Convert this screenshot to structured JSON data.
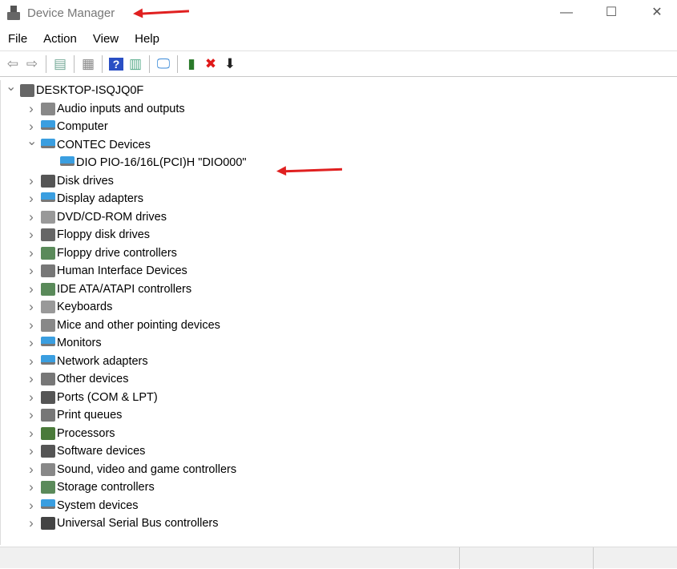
{
  "window": {
    "title": "Device Manager",
    "minimize": "—",
    "maximize": "☐",
    "close": "✕"
  },
  "menu": [
    "File",
    "Action",
    "View",
    "Help"
  ],
  "toolbar": [
    {
      "name": "back",
      "glyph": "⇦",
      "color": "#888"
    },
    {
      "name": "forward",
      "glyph": "⇨",
      "color": "#888"
    },
    {
      "sep": true
    },
    {
      "name": "show-hide-console-tree",
      "glyph": "▤",
      "color": "#7a9"
    },
    {
      "sep": true
    },
    {
      "name": "properties",
      "glyph": "▦",
      "color": "#888"
    },
    {
      "sep": true
    },
    {
      "name": "help",
      "glyph": "?",
      "color": "#fff",
      "bg": "#2a4fc4"
    },
    {
      "name": "show-action-pane",
      "glyph": "▥",
      "color": "#5a8"
    },
    {
      "sep": true
    },
    {
      "name": "scan-hardware",
      "glyph": "🖵",
      "color": "#3a8ad8"
    },
    {
      "sep": true
    },
    {
      "name": "update-driver",
      "glyph": "▮",
      "color": "#2a7a2a"
    },
    {
      "name": "uninstall",
      "glyph": "✖",
      "color": "#e01818"
    },
    {
      "name": "enable-device",
      "glyph": "⬇",
      "color": "#222"
    }
  ],
  "tree": {
    "root": "DESKTOP-ISQJQ0F",
    "items": [
      {
        "label": "Audio inputs and outputs",
        "icon": "speaker",
        "color": "#888"
      },
      {
        "label": "Computer",
        "icon": "monitor",
        "color": "#3a9ee0"
      },
      {
        "label": "CONTEC Devices",
        "icon": "network",
        "color": "#3a9ee0",
        "expanded": true,
        "children": [
          {
            "label": "DIO PIO-16/16L(PCI)H \"DIO000\"",
            "icon": "network",
            "color": "#3a9ee0"
          }
        ]
      },
      {
        "label": "Disk drives",
        "icon": "disk",
        "color": "#555"
      },
      {
        "label": "Display adapters",
        "icon": "display",
        "color": "#3a9ee0"
      },
      {
        "label": "DVD/CD-ROM drives",
        "icon": "dvd",
        "color": "#999"
      },
      {
        "label": "Floppy disk drives",
        "icon": "floppy",
        "color": "#666"
      },
      {
        "label": "Floppy drive controllers",
        "icon": "controller",
        "color": "#5a8a5a"
      },
      {
        "label": "Human Interface Devices",
        "icon": "hid",
        "color": "#777"
      },
      {
        "label": "IDE ATA/ATAPI controllers",
        "icon": "ide",
        "color": "#5a8a5a"
      },
      {
        "label": "Keyboards",
        "icon": "keyboard",
        "color": "#999"
      },
      {
        "label": "Mice and other pointing devices",
        "icon": "mouse",
        "color": "#888"
      },
      {
        "label": "Monitors",
        "icon": "monitor",
        "color": "#3a9ee0"
      },
      {
        "label": "Network adapters",
        "icon": "network",
        "color": "#3a9ee0"
      },
      {
        "label": "Other devices",
        "icon": "unknown",
        "color": "#777"
      },
      {
        "label": "Ports (COM & LPT)",
        "icon": "port",
        "color": "#555"
      },
      {
        "label": "Print queues",
        "icon": "printer",
        "color": "#777"
      },
      {
        "label": "Processors",
        "icon": "cpu",
        "color": "#4a7a3a"
      },
      {
        "label": "Software devices",
        "icon": "software",
        "color": "#555"
      },
      {
        "label": "Sound, video and game controllers",
        "icon": "speaker",
        "color": "#888"
      },
      {
        "label": "Storage controllers",
        "icon": "storage",
        "color": "#5a8a5a"
      },
      {
        "label": "System devices",
        "icon": "system",
        "color": "#3a9ee0"
      },
      {
        "label": "Universal Serial Bus controllers",
        "icon": "usb",
        "color": "#444"
      }
    ]
  },
  "accent": "#e02020"
}
